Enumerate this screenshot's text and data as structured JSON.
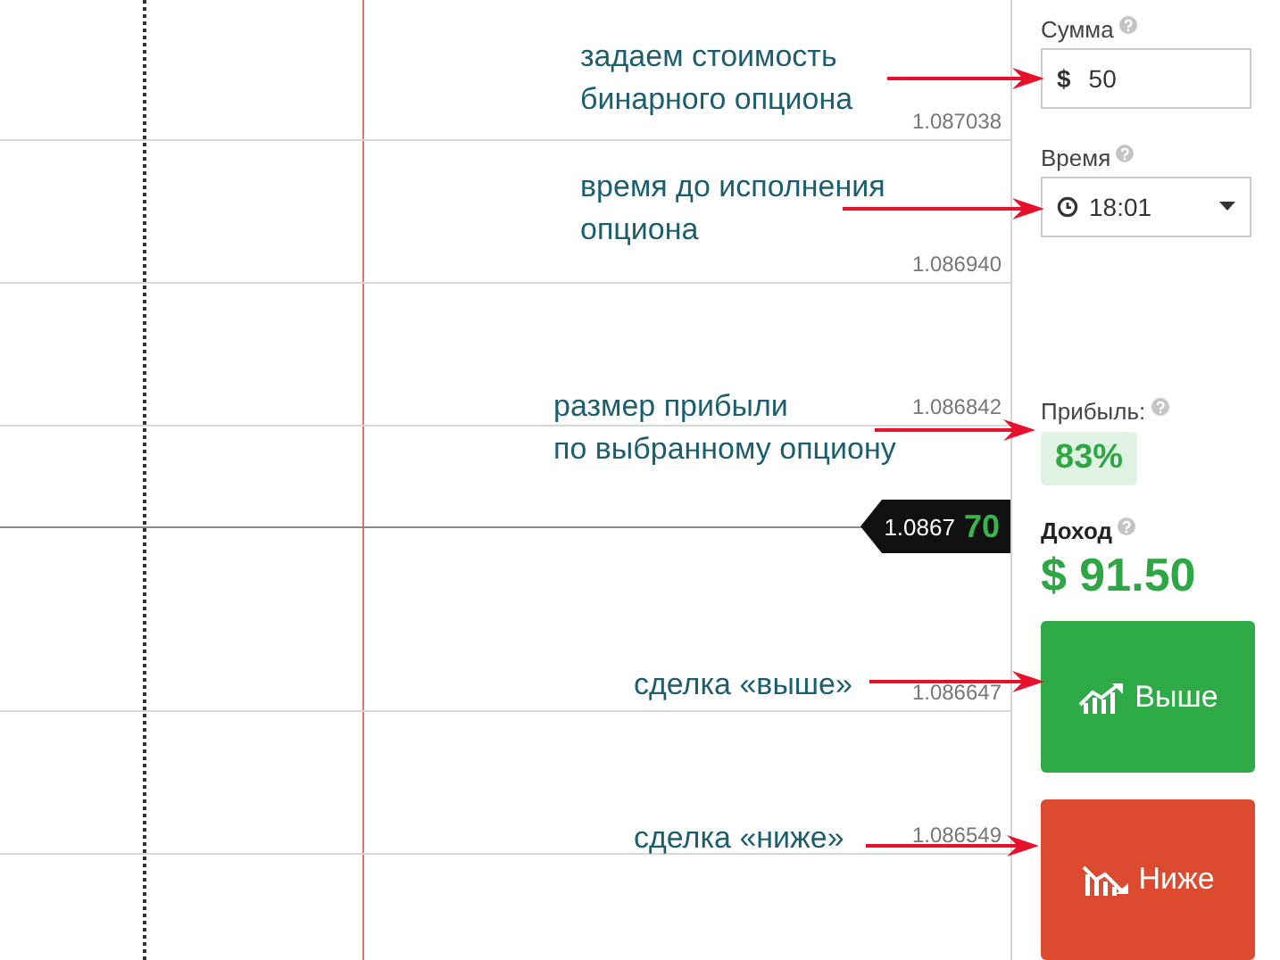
{
  "chart": {
    "price_levels": [
      "1.087038",
      "1.086940",
      "1.086842",
      "1.086647",
      "1.086549"
    ],
    "current_price": {
      "main": "1.0867",
      "last": "70"
    }
  },
  "annotations": [
    {
      "text": "задаем стоимость\nбинарного опциона"
    },
    {
      "text": "время до исполнения\nопциона"
    },
    {
      "text": "размер прибыли\nпо выбранному опциону"
    },
    {
      "text": "сделка «выше»"
    },
    {
      "text": "сделка «ниже»"
    }
  ],
  "sidebar": {
    "amount": {
      "label": "Сумма",
      "currency": "$",
      "value": "50"
    },
    "time": {
      "label": "Время",
      "value": "18:01"
    },
    "profit": {
      "label": "Прибыль:",
      "value": "83%"
    },
    "income": {
      "label": "Доход",
      "value": "$ 91.50"
    },
    "buttons": [
      {
        "kind": "up",
        "label": "Выше"
      },
      {
        "kind": "down",
        "label": "Ниже"
      }
    ]
  }
}
